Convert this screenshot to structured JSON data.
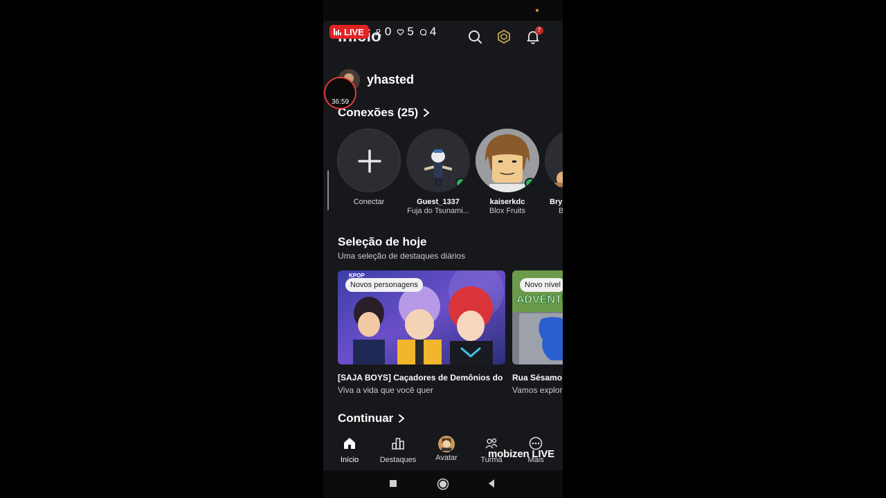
{
  "overlay": {
    "live_label": "LIVE",
    "viewers": "0",
    "likes": "5",
    "comments": "4",
    "timer": "36:59",
    "recorder_brand": "mobizen LIVE"
  },
  "header": {
    "title": "Início",
    "notification_count": "7"
  },
  "profile": {
    "username": "yhasted"
  },
  "connections": {
    "title": "Conexões (25)",
    "items": [
      {
        "name": "Conectar",
        "game": ""
      },
      {
        "name": "Guest_1337",
        "game": "Fuja do Tsunami..."
      },
      {
        "name": "kaiserkdc",
        "game": "Blox Fruits"
      },
      {
        "name": "Bry",
        "game": "B"
      }
    ]
  },
  "today": {
    "title": "Seleção de hoje",
    "subtitle": "Uma seleção de destaques diários",
    "cards": [
      {
        "tag": "Novos personagens",
        "logo": "KPOP",
        "title": "[SAJA BOYS] Caçadores de Demônios do ...",
        "subtitle": "Viva a vida que você quer"
      },
      {
        "tag": "Novo nível",
        "logo": "ADVENTU",
        "title": "Rua Sésamo:",
        "subtitle": "Vamos explor"
      }
    ]
  },
  "continue": {
    "title": "Continuar"
  },
  "bottom_nav": [
    {
      "label": "Início",
      "icon": "home-icon"
    },
    {
      "label": "Destaques",
      "icon": "chart-icon"
    },
    {
      "label": "Avatar",
      "icon": "avatar-icon"
    },
    {
      "label": "Turma",
      "icon": "group-icon"
    },
    {
      "label": "Mais",
      "icon": "more-icon"
    }
  ],
  "colors": {
    "live_red": "#e02424",
    "online_green": "#2cb25a",
    "background": "#17181b"
  }
}
